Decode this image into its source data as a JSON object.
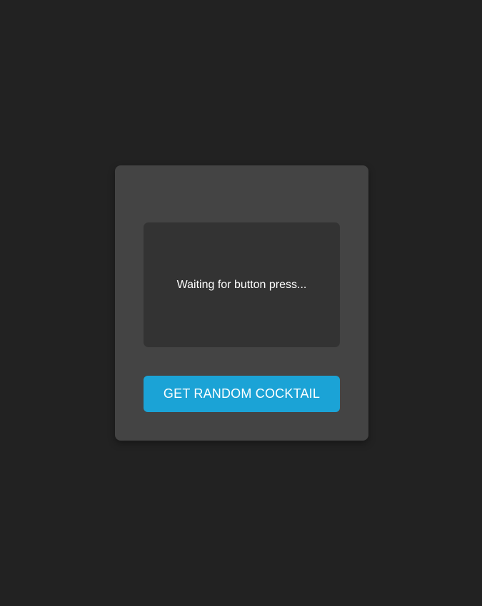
{
  "card": {
    "status_text": "Waiting for button press...",
    "button_label": "GET RANDOM COCKTAIL"
  },
  "colors": {
    "background": "#222222",
    "card": "#444444",
    "display": "#333333",
    "accent": "#1ba3d6",
    "text": "#ffffff"
  }
}
